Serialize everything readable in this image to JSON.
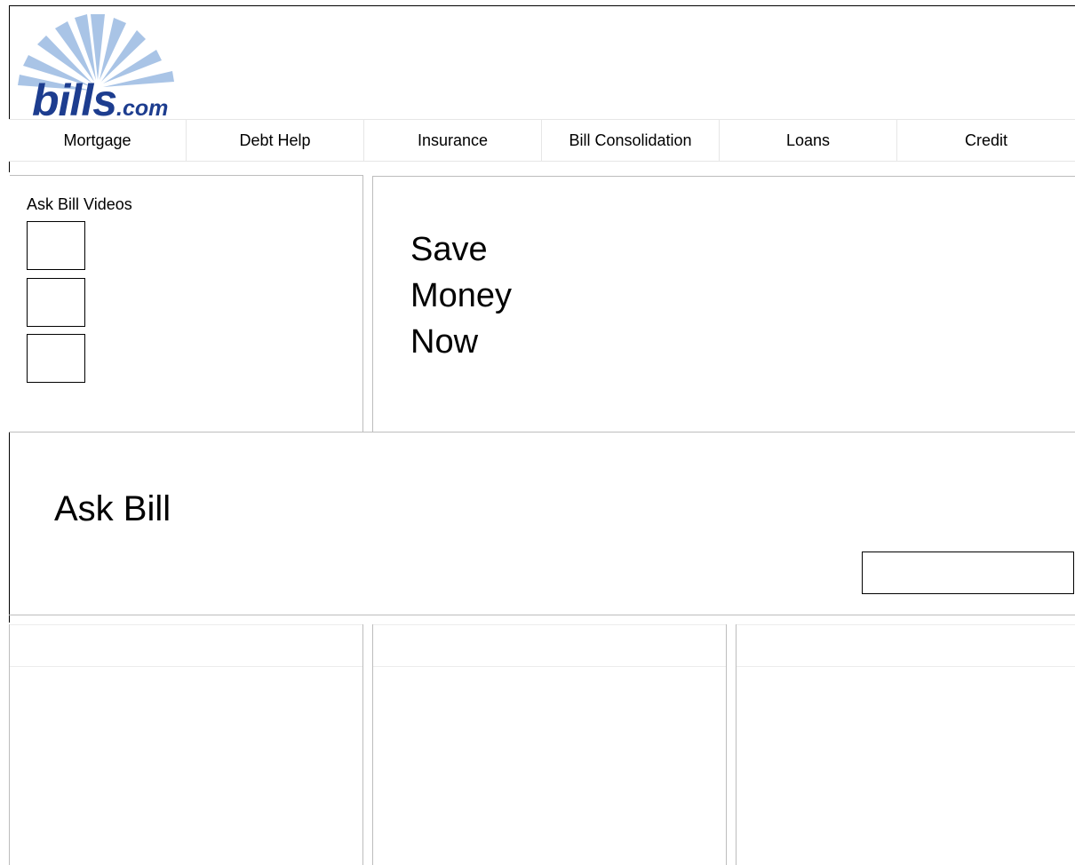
{
  "logo": {
    "wordmark": "bills",
    "suffix": ".com",
    "color": "#1d3d8f",
    "sunburst_color": "#a9c4e6"
  },
  "nav": {
    "items": [
      {
        "label": "Mortgage"
      },
      {
        "label": "Debt Help"
      },
      {
        "label": "Insurance"
      },
      {
        "label": "Bill Consolidation"
      },
      {
        "label": "Loans"
      },
      {
        "label": "Credit"
      }
    ]
  },
  "videos": {
    "title": "Ask Bill Videos",
    "thumbnails": [
      {
        "icon": "video-thumbnail"
      },
      {
        "icon": "video-thumbnail"
      },
      {
        "icon": "video-thumbnail"
      }
    ]
  },
  "hero": {
    "line1": "Save",
    "line2": "Money",
    "line3": "Now"
  },
  "ask": {
    "title": "Ask Bill",
    "input_value": "",
    "input_placeholder": ""
  },
  "columns": [
    {
      "header": ""
    },
    {
      "header": ""
    },
    {
      "header": ""
    }
  ],
  "colors": {
    "divider": "#bdbdbd",
    "light_divider": "#e6e6e6"
  }
}
